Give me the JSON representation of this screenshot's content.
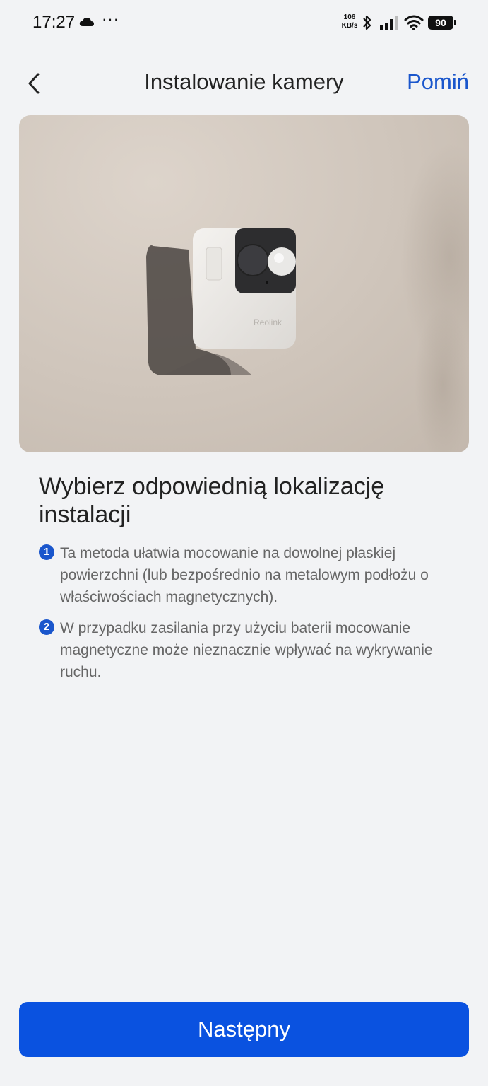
{
  "status_bar": {
    "time": "17:27",
    "net_speed_value": "106",
    "net_speed_unit": "KB/s",
    "battery": "90",
    "icons": [
      "cloud-icon",
      "more-icon",
      "bluetooth-icon",
      "signal-icon",
      "wifi-icon",
      "battery-icon"
    ]
  },
  "header": {
    "title": "Instalowanie kamery",
    "skip_label": "Pomiń",
    "back_icon": "chevron-left-icon"
  },
  "hero": {
    "camera_logo": "Reolink"
  },
  "content": {
    "heading": "Wybierz odpowiednią lokalizację instalacji",
    "notes": [
      {
        "number": "1",
        "text": "Ta metoda ułatwia mocowanie na dowolnej płaskiej powierzchni (lub bezpośrednio na metalowym podłożu o właściwościach magnetycznych)."
      },
      {
        "number": "2",
        "text": "W przypadku zasilania przy użyciu baterii mocowanie magnetyczne może nieznacznie wpływać na wykrywanie ruchu."
      }
    ]
  },
  "footer": {
    "next_label": "Następny"
  },
  "colors": {
    "accent": "#0a52e0",
    "link": "#1a56cc",
    "background": "#f2f3f5"
  }
}
